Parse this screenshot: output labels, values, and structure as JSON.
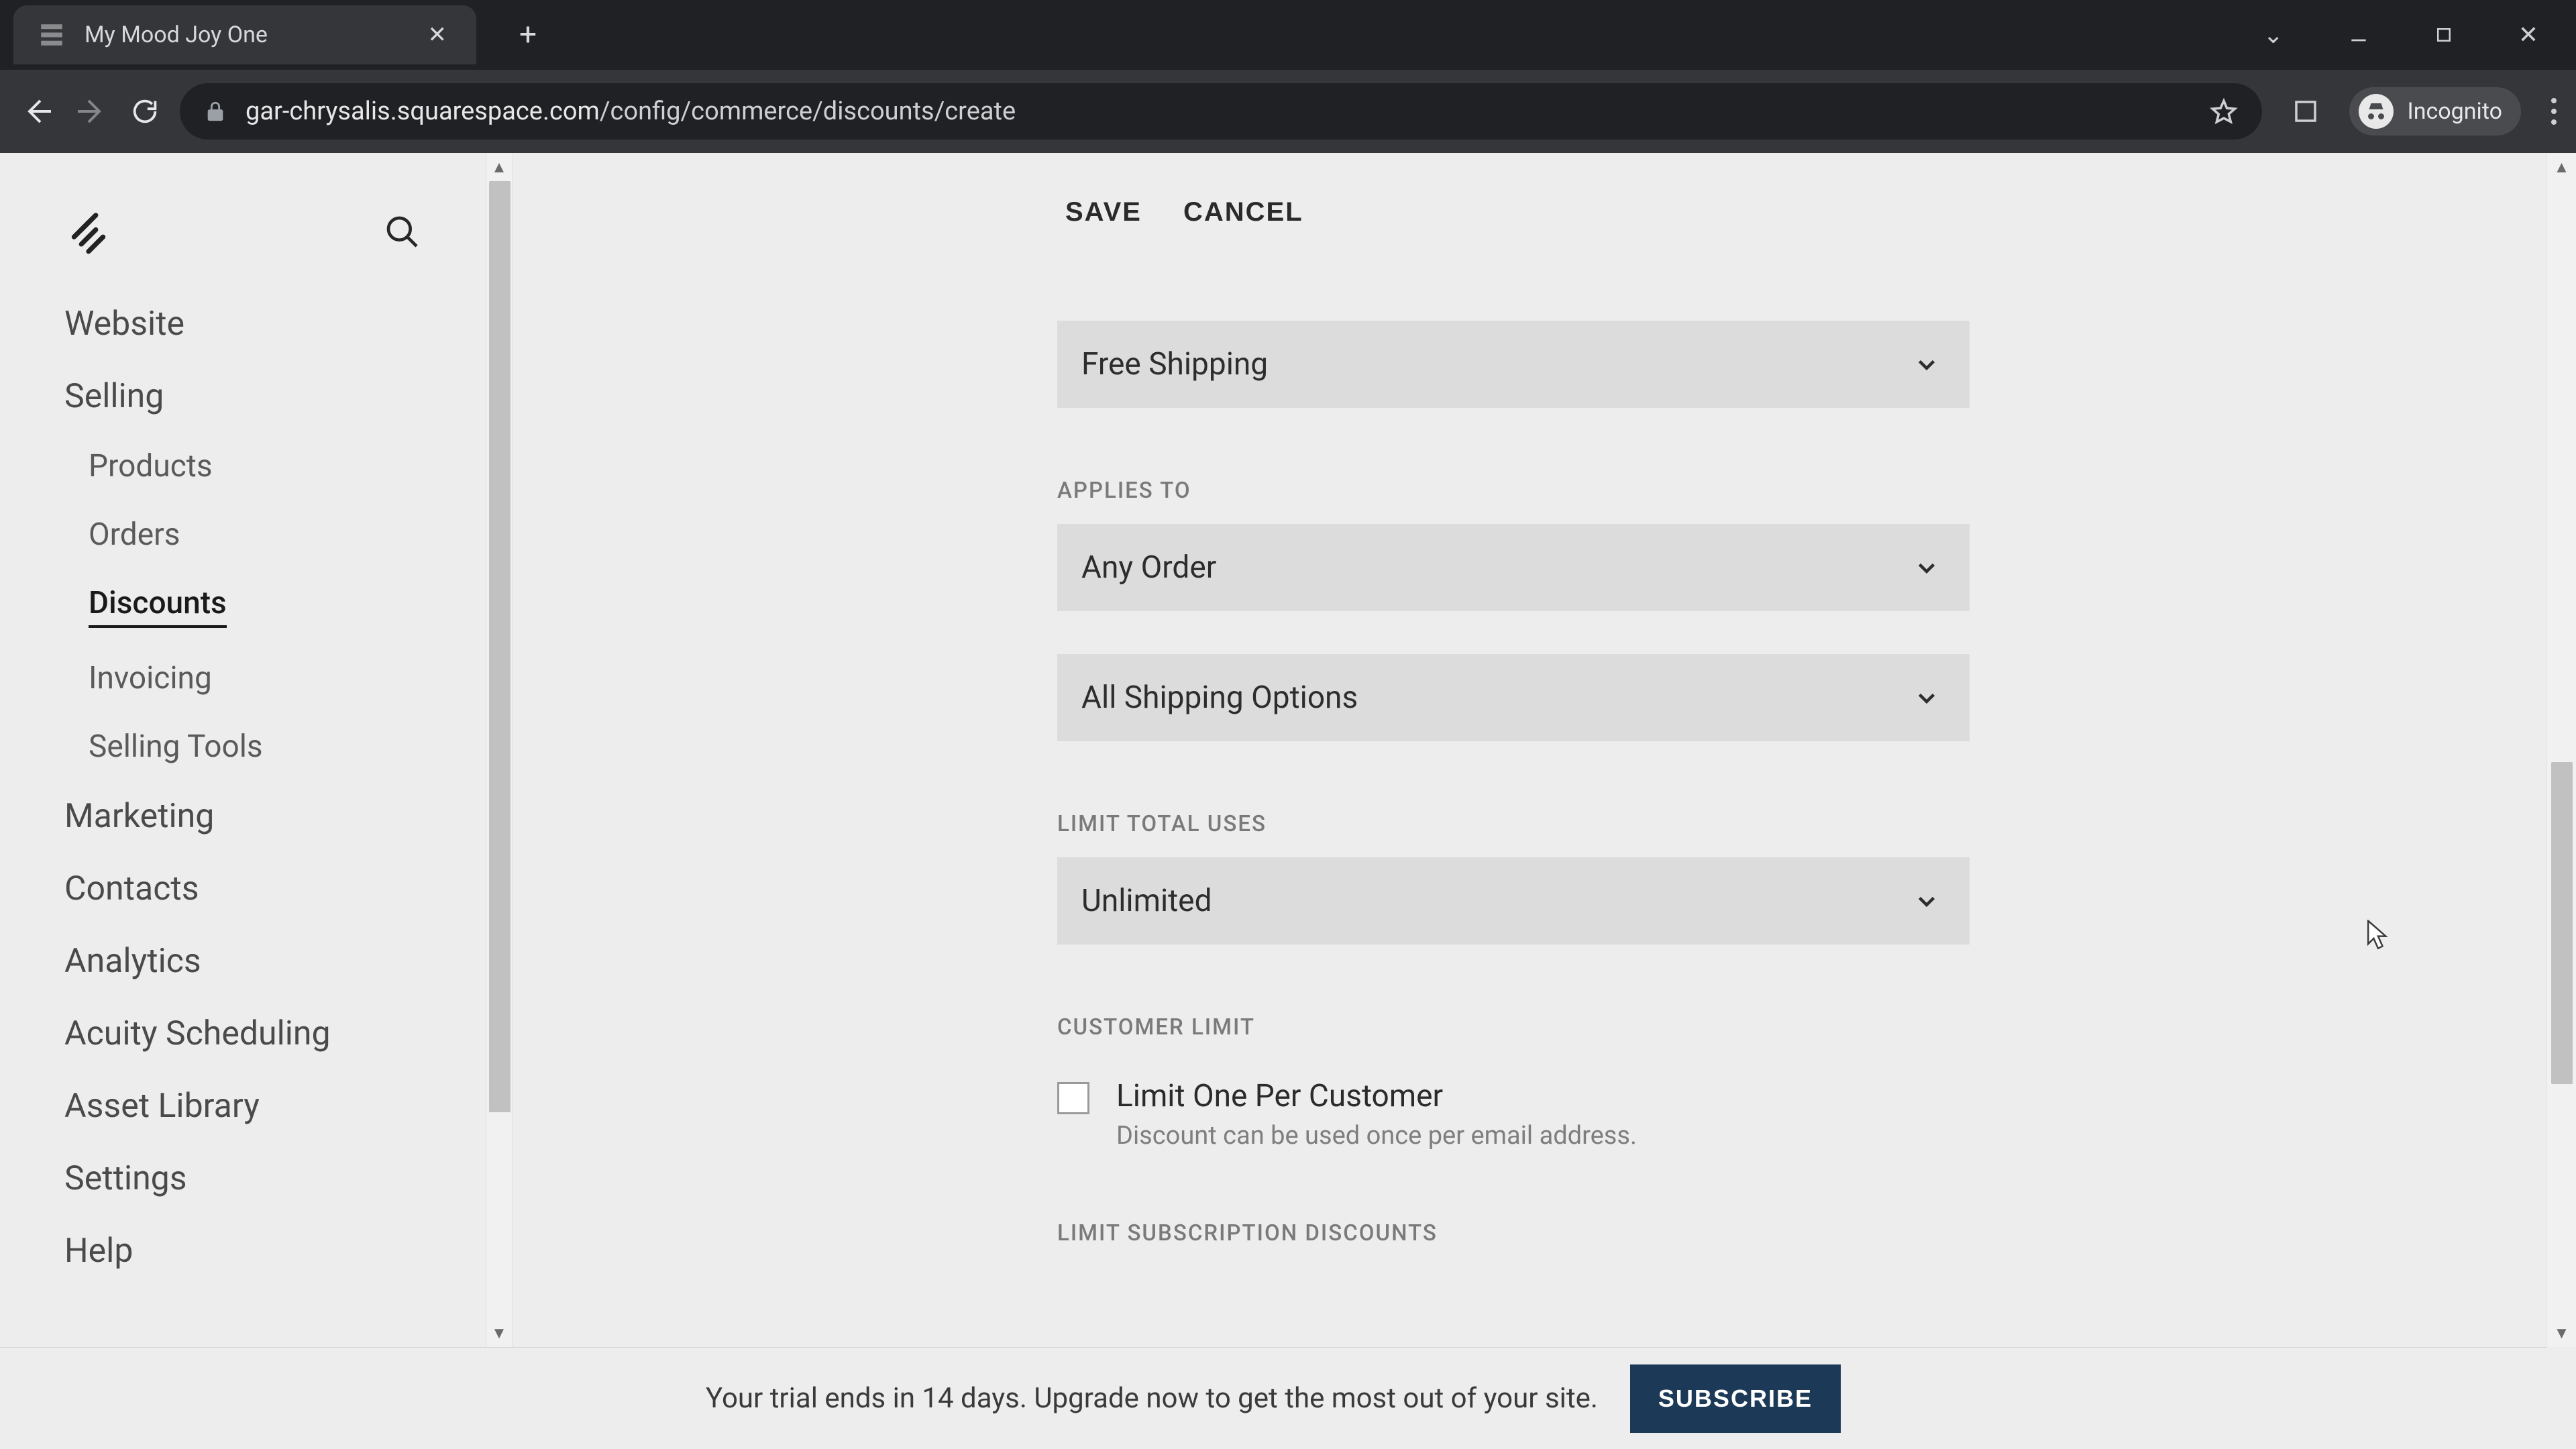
{
  "browser": {
    "tab_title": "My Mood Joy One",
    "url_host": "gar-chrysalis.squarespace.com",
    "url_path": "/config/commerce/discounts/create",
    "incognito_label": "Incognito"
  },
  "sidebar": {
    "items": [
      {
        "label": "Website"
      },
      {
        "label": "Selling",
        "children": [
          {
            "label": "Products"
          },
          {
            "label": "Orders"
          },
          {
            "label": "Discounts",
            "active": true
          },
          {
            "label": "Invoicing"
          },
          {
            "label": "Selling Tools"
          }
        ]
      },
      {
        "label": "Marketing"
      },
      {
        "label": "Contacts"
      },
      {
        "label": "Analytics"
      },
      {
        "label": "Acuity Scheduling"
      },
      {
        "label": "Asset Library"
      },
      {
        "label": "Settings"
      },
      {
        "label": "Help"
      }
    ]
  },
  "actions": {
    "save": "SAVE",
    "cancel": "CANCEL"
  },
  "form": {
    "promotion_type_value": "Free Shipping",
    "applies_to_label": "APPLIES TO",
    "applies_to_value": "Any Order",
    "shipping_options_value": "All Shipping Options",
    "limit_total_uses_label": "LIMIT TOTAL USES",
    "limit_total_uses_value": "Unlimited",
    "customer_limit_label": "CUSTOMER LIMIT",
    "customer_limit_checkbox_label": "Limit One Per Customer",
    "customer_limit_checkbox_desc": "Discount can be used once per email address.",
    "limit_subscription_label": "LIMIT SUBSCRIPTION DISCOUNTS"
  },
  "trial_banner": {
    "message": "Your trial ends in 14 days. Upgrade now to get the most out of your site.",
    "subscribe": "SUBSCRIBE"
  }
}
